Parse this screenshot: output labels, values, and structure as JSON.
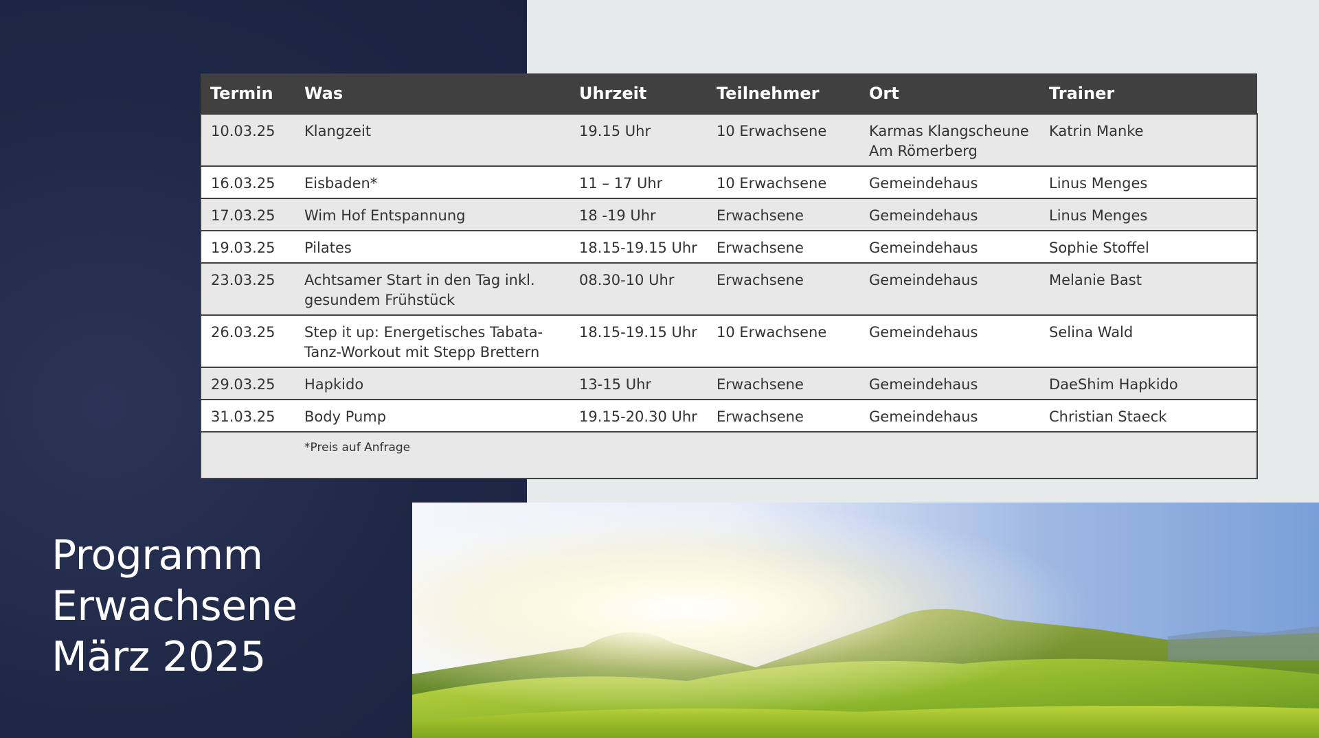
{
  "title": {
    "line1": "Programm",
    "line2": "Erwachsene",
    "line3": "März 2025"
  },
  "table": {
    "headers": [
      "Termin",
      "Was",
      "Uhrzeit",
      "Teilnehmer",
      "Ort",
      "Trainer"
    ],
    "rows": [
      {
        "termin": "10.03.25",
        "was": "Klangzeit",
        "uhrzeit": "19.15 Uhr",
        "teilnehmer": "10 Erwachsene",
        "ort": "Karmas Klangscheune Am Römerberg",
        "trainer": "Katrin Manke"
      },
      {
        "termin": "16.03.25",
        "was": "Eisbaden*",
        "uhrzeit": "11 – 17 Uhr",
        "teilnehmer": "10 Erwachsene",
        "ort": "Gemeindehaus",
        "trainer": "Linus Menges"
      },
      {
        "termin": "17.03.25",
        "was": "Wim Hof Entspannung",
        "uhrzeit": "18 -19 Uhr",
        "teilnehmer": "Erwachsene",
        "ort": "Gemeindehaus",
        "trainer": "Linus Menges"
      },
      {
        "termin": "19.03.25",
        "was": "Pilates",
        "uhrzeit": "18.15-19.15 Uhr",
        "teilnehmer": "Erwachsene",
        "ort": "Gemeindehaus",
        "trainer": "Sophie Stoffel"
      },
      {
        "termin": "23.03.25",
        "was": "Achtsamer Start in den Tag inkl. gesundem Frühstück",
        "uhrzeit": "08.30-10 Uhr",
        "teilnehmer": "Erwachsene",
        "ort": "Gemeindehaus",
        "trainer": "Melanie Bast"
      },
      {
        "termin": "26.03.25",
        "was": "Step it up: Energetisches Tabata-Tanz-Workout mit Stepp Brettern",
        "uhrzeit": "18.15-19.15 Uhr",
        "teilnehmer": "10 Erwachsene",
        "ort": "Gemeindehaus",
        "trainer": "Selina Wald"
      },
      {
        "termin": "29.03.25",
        "was": "Hapkido",
        "uhrzeit": "13-15 Uhr",
        "teilnehmer": "Erwachsene",
        "ort": "Gemeindehaus",
        "trainer": "DaeShim Hapkido"
      },
      {
        "termin": "31.03.25",
        "was": "Body Pump",
        "uhrzeit": "19.15-20.30 Uhr",
        "teilnehmer": "Erwachsene",
        "ort": "Gemeindehaus",
        "trainer": "Christian Staeck"
      }
    ],
    "footnote": "*Preis auf Anfrage"
  },
  "colors": {
    "navy": "#1f2746",
    "header": "#404040",
    "row_shade": "#e8e8e8"
  }
}
